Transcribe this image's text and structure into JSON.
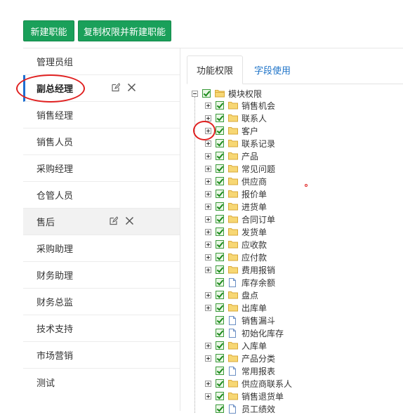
{
  "toolbar": {
    "new_role": "新建职能",
    "copy_role": "复制权限并新建职能"
  },
  "roles": [
    "管理员组",
    "副总经理",
    "销售经理",
    "销售人员",
    "采购经理",
    "仓管人员",
    "售后",
    "采购助理",
    "财务助理",
    "财务总监",
    "技术支持",
    "市场营销",
    "测试"
  ],
  "active_role": "副总经理",
  "tabs": {
    "function_permissions": "功能权限",
    "field_usage": "字段使用"
  },
  "tree": {
    "root": "模块权限",
    "items": [
      {
        "label": "销售机会",
        "type": "folder"
      },
      {
        "label": "联系人",
        "type": "folder"
      },
      {
        "label": "客户",
        "type": "folder"
      },
      {
        "label": "联系记录",
        "type": "folder"
      },
      {
        "label": "产品",
        "type": "folder"
      },
      {
        "label": "常见问题",
        "type": "folder"
      },
      {
        "label": "供应商",
        "type": "folder"
      },
      {
        "label": "报价单",
        "type": "folder"
      },
      {
        "label": "进货单",
        "type": "folder"
      },
      {
        "label": "合同订单",
        "type": "folder"
      },
      {
        "label": "发货单",
        "type": "folder"
      },
      {
        "label": "应收款",
        "type": "folder"
      },
      {
        "label": "应付款",
        "type": "folder"
      },
      {
        "label": "费用报销",
        "type": "folder"
      },
      {
        "label": "库存余额",
        "type": "file"
      },
      {
        "label": "盘点",
        "type": "folder"
      },
      {
        "label": "出库单",
        "type": "folder"
      },
      {
        "label": "销售漏斗",
        "type": "file"
      },
      {
        "label": "初始化库存",
        "type": "file"
      },
      {
        "label": "入库单",
        "type": "folder"
      },
      {
        "label": "产品分类",
        "type": "folder"
      },
      {
        "label": "常用报表",
        "type": "file"
      },
      {
        "label": "供应商联系人",
        "type": "folder"
      },
      {
        "label": "销售退货单",
        "type": "folder"
      },
      {
        "label": "员工绩效",
        "type": "file"
      }
    ]
  },
  "colors": {
    "primary_button": "#1aa05a",
    "active_accent": "#1e6fd1",
    "annotation": "#e02020"
  }
}
